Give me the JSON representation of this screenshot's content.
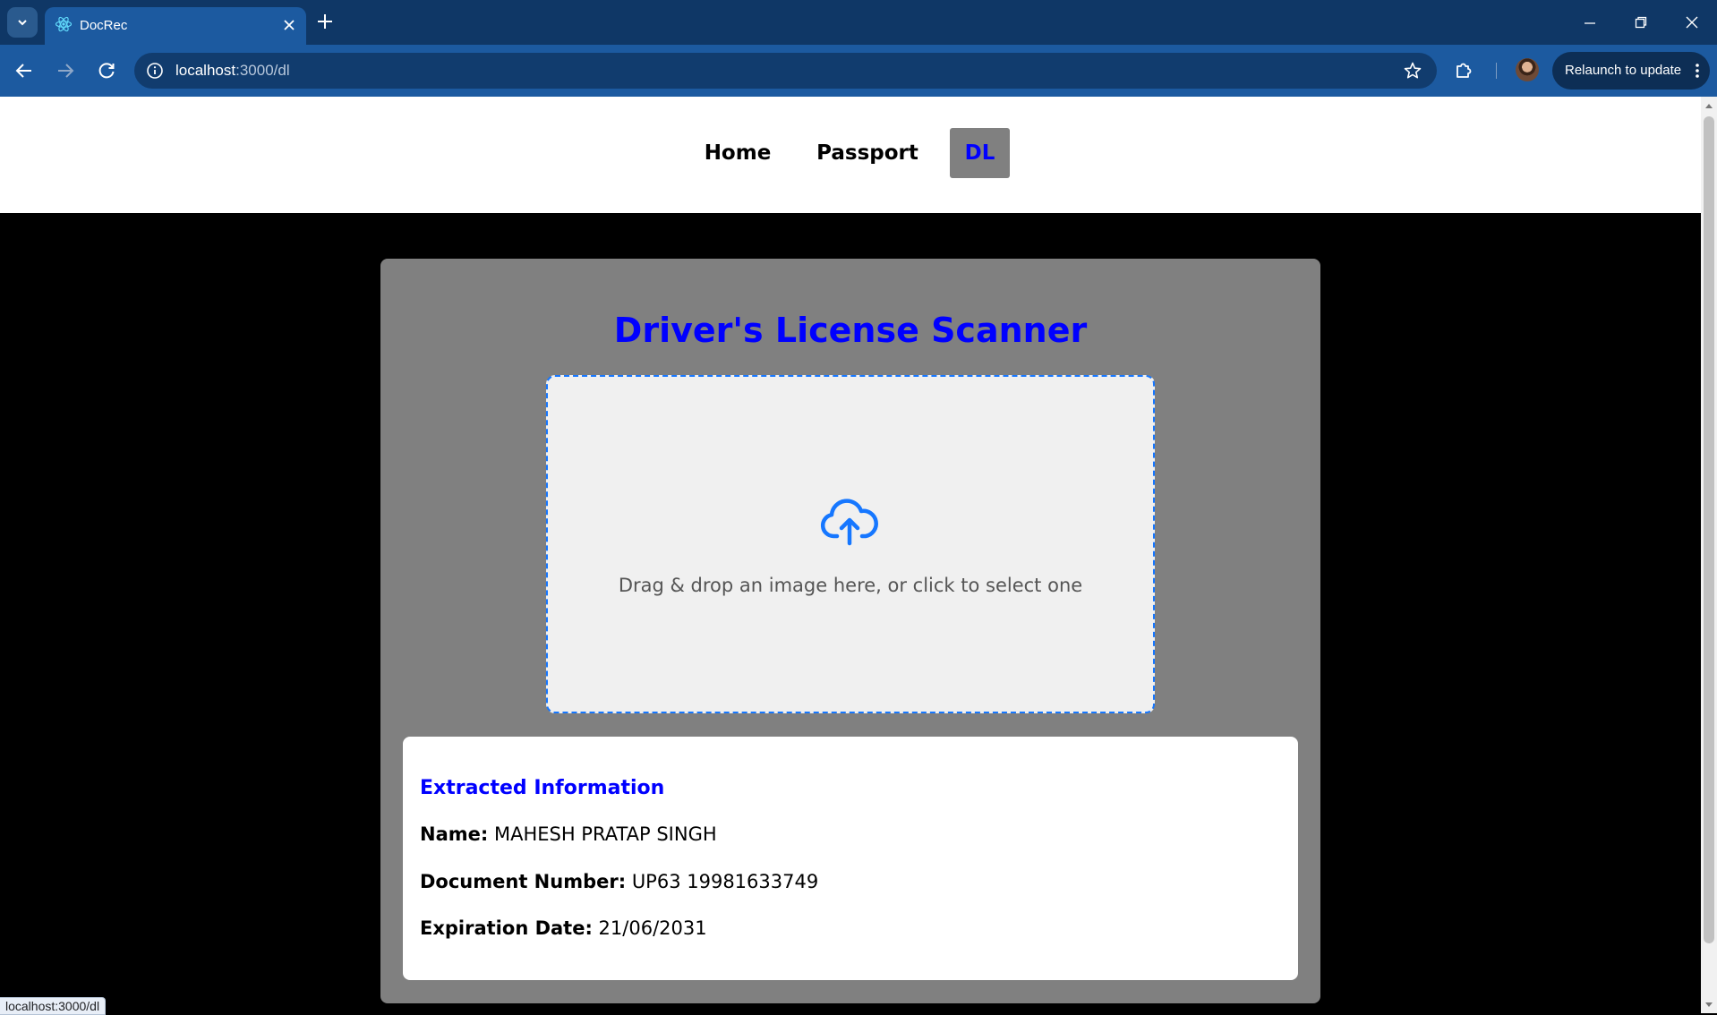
{
  "browser": {
    "tab": {
      "title": "DocRec",
      "favicon": "react-logo-icon"
    },
    "url": {
      "host": "localhost",
      "path": ":3000/dl"
    },
    "relaunch_label": "Relaunch to update",
    "status_url": "localhost:3000/dl"
  },
  "nav": {
    "items": [
      {
        "label": "Home",
        "active": false
      },
      {
        "label": "Passport",
        "active": false
      },
      {
        "label": "DL",
        "active": true
      }
    ]
  },
  "scanner": {
    "title": "Driver's License Scanner",
    "dropzone_text": "Drag & drop an image here, or click to select one",
    "dropzone_icon": "cloud-upload-icon"
  },
  "extracted": {
    "heading": "Extracted Information",
    "name_label": "Name:",
    "name_value": "MAHESH PRATAP SINGH",
    "doc_label": "Document Number:",
    "doc_value": "UP63 19981633749",
    "exp_label": "Expiration Date:",
    "exp_value": "21/06/2031"
  },
  "colors": {
    "accent": "#0000ff",
    "dropzone_border": "#1677ff",
    "card_bg": "#808080",
    "page_bg": "#000000",
    "chrome_tab": "#1c5aa0",
    "chrome_bar": "#0f3766"
  }
}
